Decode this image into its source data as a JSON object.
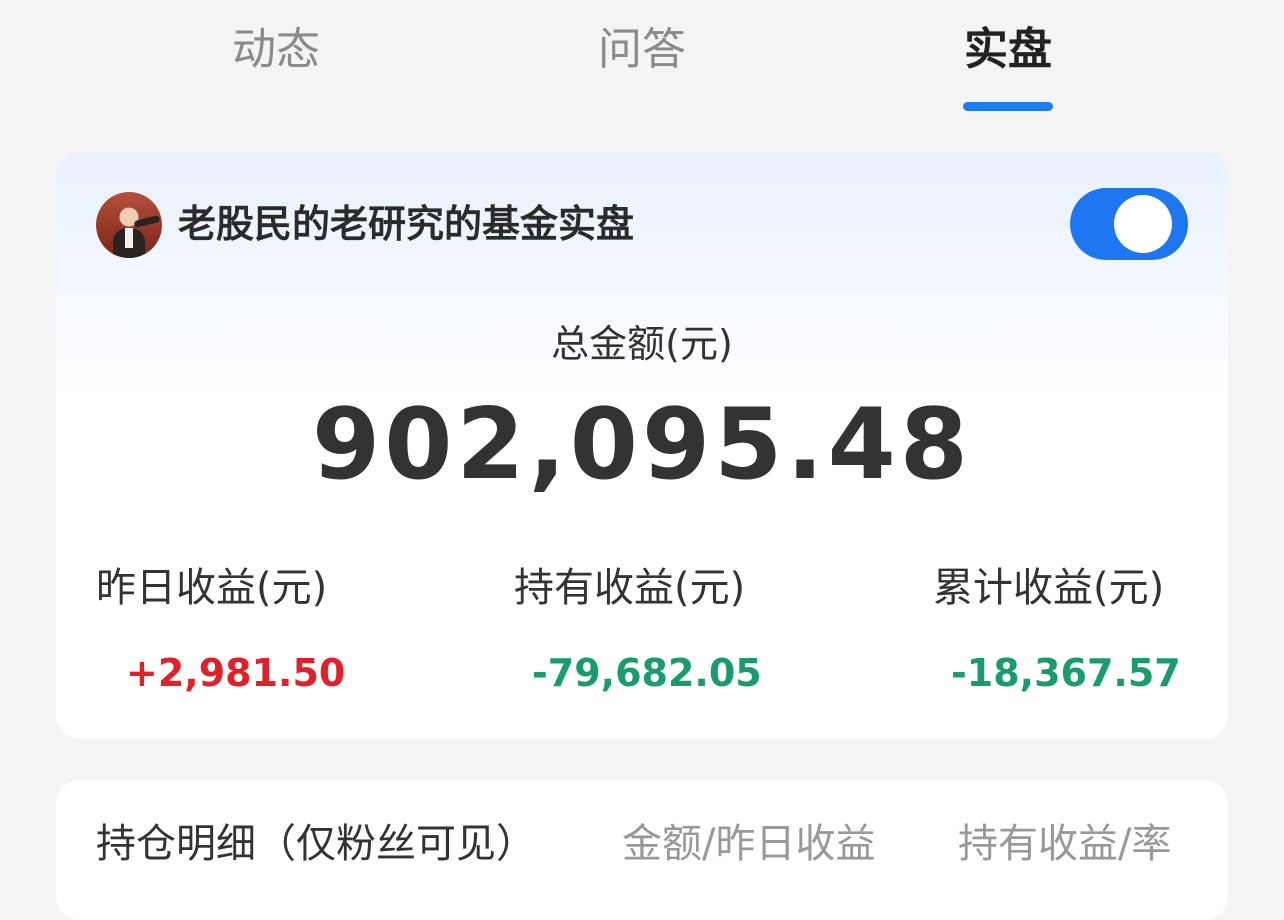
{
  "tabs": [
    {
      "label": "动态",
      "active": false
    },
    {
      "label": "问答",
      "active": false
    },
    {
      "label": "实盘",
      "active": true
    }
  ],
  "accent_color": "#1f7cf2",
  "account": {
    "name": "老股民的老研究的基金实盘",
    "toggle_on": true
  },
  "summary": {
    "total_label": "总金额(元)",
    "total_amount": "902,095.48",
    "stats": [
      {
        "label": "昨日收益(元)",
        "value": "+2,981.50",
        "color": "#e0202a"
      },
      {
        "label": "持有收益(元)",
        "value": "-79,682.05",
        "color": "#1a9b6c"
      },
      {
        "label": "累计收益(元)",
        "value": "-18,367.57",
        "color": "#1a9b6c"
      }
    ]
  },
  "holdings": {
    "title": "持仓明细（仅粉丝可见）",
    "columns": [
      "金额/昨日收益",
      "持有收益/率"
    ]
  }
}
